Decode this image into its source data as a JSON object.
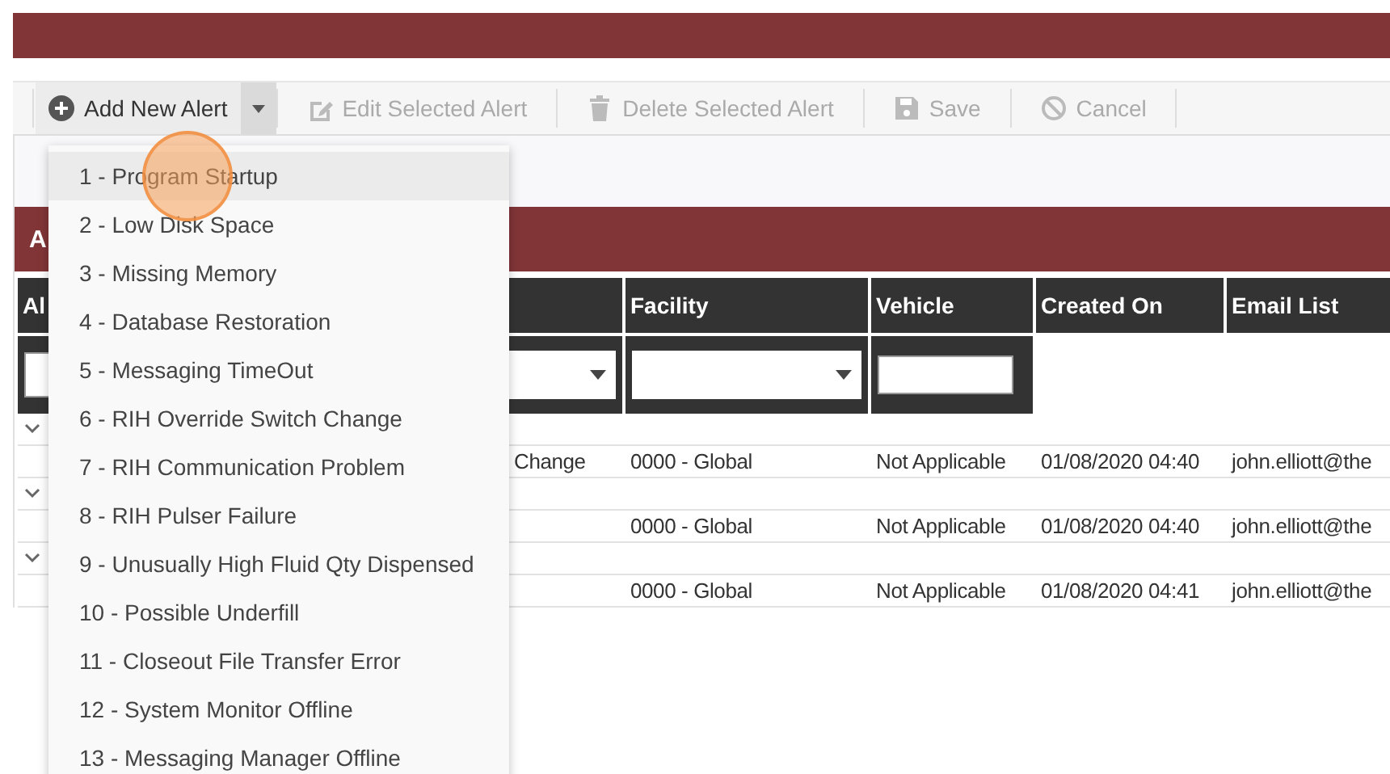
{
  "toolbar": {
    "buttons": [
      {
        "kind": "add",
        "label": "Add New Alert",
        "disabled": false
      },
      {
        "kind": "edit",
        "label": "Edit Selected Alert",
        "disabled": true
      },
      {
        "kind": "delete",
        "label": "Delete Selected Alert",
        "disabled": true
      },
      {
        "kind": "save",
        "label": "Save",
        "disabled": true
      },
      {
        "kind": "cancel",
        "label": "Cancel",
        "disabled": true
      }
    ]
  },
  "add_menu": {
    "expanded": true,
    "items": [
      {
        "label": "1 - Program Startup",
        "selected": true
      },
      {
        "label": "2 - Low Disk Space",
        "selected": false
      },
      {
        "label": "3 - Missing Memory",
        "selected": false
      },
      {
        "label": "4 - Database Restoration",
        "selected": false
      },
      {
        "label": "5 - Messaging TimeOut",
        "selected": false
      },
      {
        "label": "6 - RIH Override Switch Change",
        "selected": false
      },
      {
        "label": "7 - RIH Communication Problem",
        "selected": false
      },
      {
        "label": "8 - RIH Pulser Failure",
        "selected": false
      },
      {
        "label": "9 - Unusually High Fluid Qty Dispensed",
        "selected": false
      },
      {
        "label": "10 - Possible Underfill",
        "selected": false
      },
      {
        "label": "11 - Closeout File Transfer Error",
        "selected": false
      },
      {
        "label": "12 - System Monitor Offline",
        "selected": false
      },
      {
        "label": "13 - Messaging Manager Offline",
        "selected": false
      }
    ]
  },
  "panel": {
    "title": "A"
  },
  "table": {
    "columns": [
      {
        "label": "Al"
      },
      {},
      {
        "label": "Facility"
      },
      {
        "label": "Vehicle"
      },
      {
        "label": "Created On"
      },
      {
        "label": "Email List"
      }
    ],
    "filters": [
      {
        "kind": "text"
      },
      {
        "kind": "dropdown"
      },
      {
        "kind": "dropdown"
      },
      {
        "kind": "text"
      },
      {
        "kind": "none"
      },
      {
        "kind": "none"
      }
    ],
    "groups": [
      {
        "expanded": true,
        "row": {
          "column_2": "Change",
          "facility": "0000 - Global",
          "vehicle": "Not Applicable",
          "created_on": "01/08/2020 04:40",
          "email_list": "john.elliott@the"
        }
      },
      {
        "expanded": true,
        "row": {
          "facility": "0000 - Global",
          "vehicle": "Not Applicable",
          "created_on": "01/08/2020 04:40",
          "email_list": "john.elliott@the"
        }
      },
      {
        "expanded": true,
        "row": {
          "facility": "0000 - Global",
          "vehicle": "Not Applicable",
          "created_on": "01/08/2020 04:41",
          "email_list": "john.elliott@the"
        }
      }
    ]
  }
}
